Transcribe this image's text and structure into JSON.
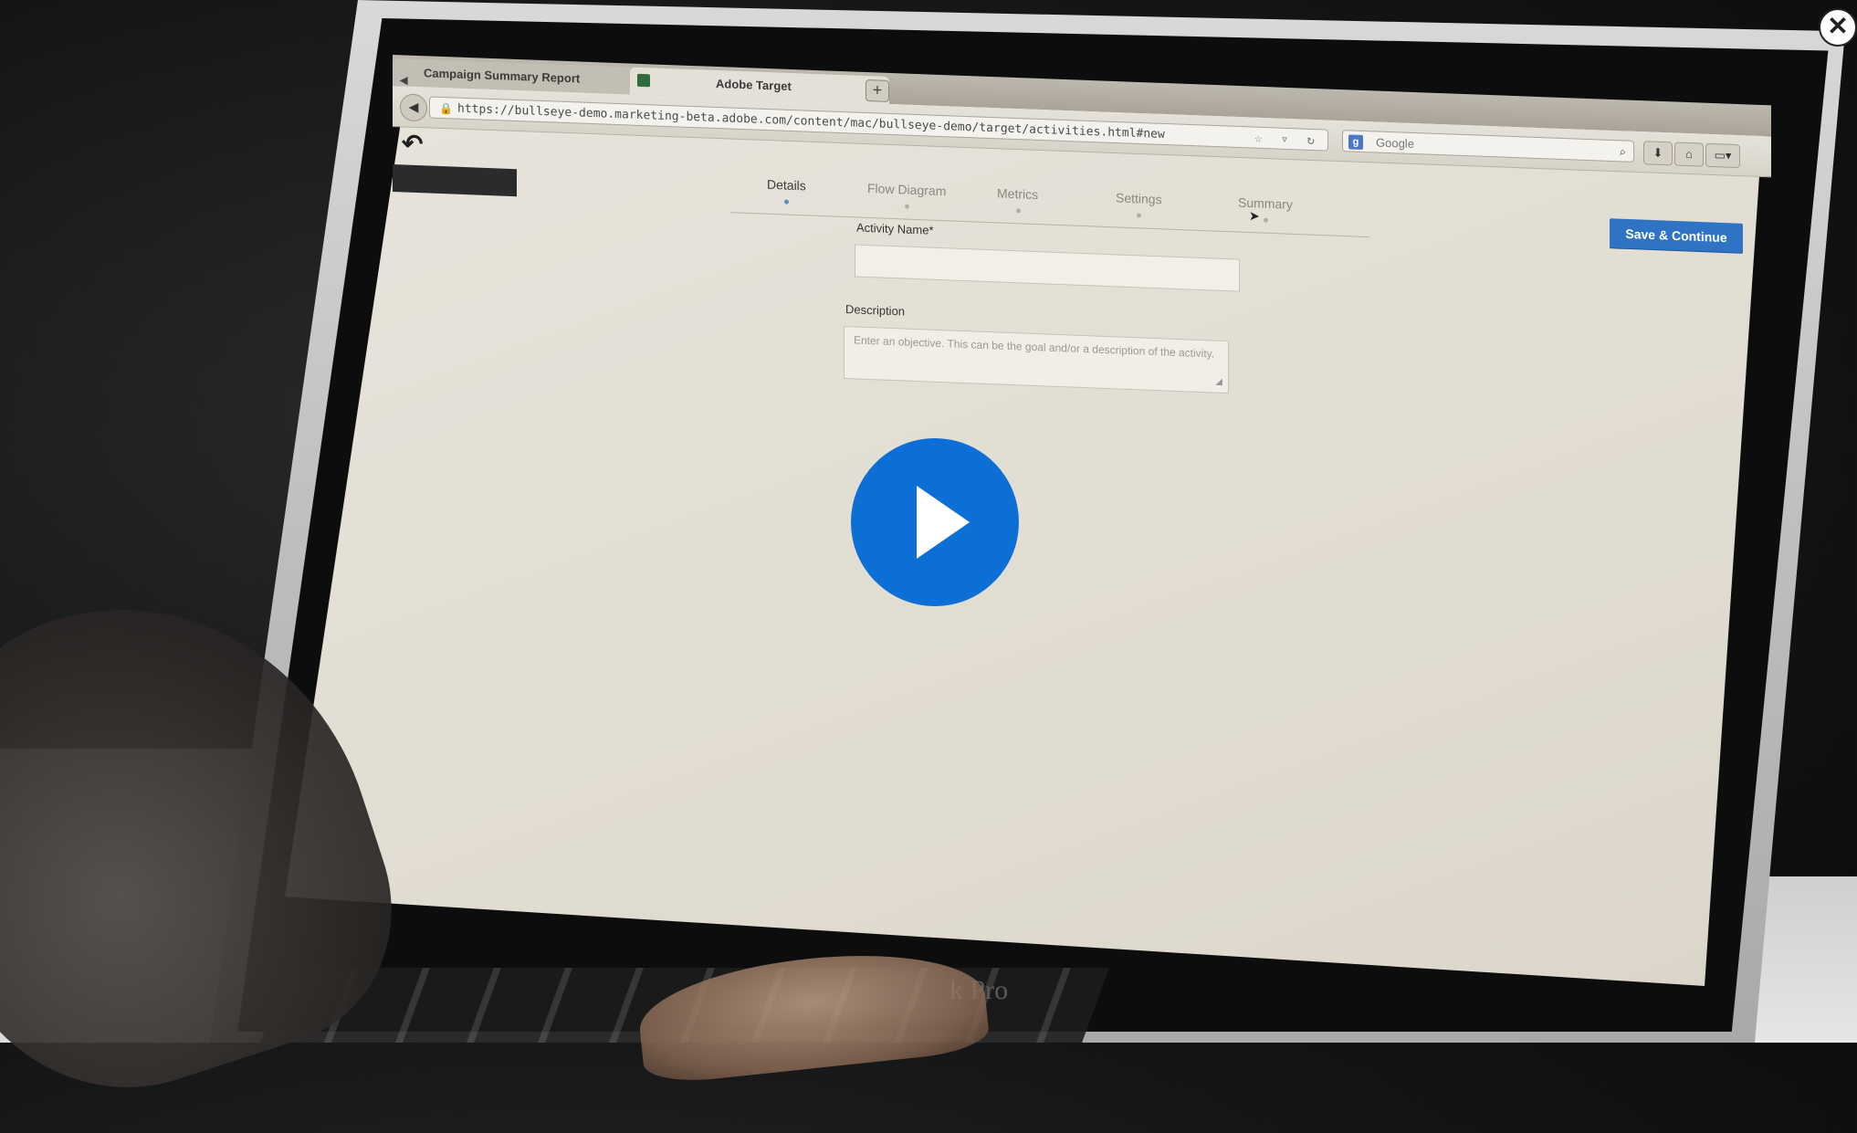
{
  "browser": {
    "tabs": [
      {
        "label": "Campaign Summary Report",
        "active": false
      },
      {
        "label": "Adobe Target",
        "active": true
      }
    ],
    "new_tab_label": "+",
    "url": "https://bullseye-demo.marketing-beta.adobe.com/content/mac/bullseye-demo/target/activities.html#new",
    "search_placeholder": "Google"
  },
  "app": {
    "steps": [
      "Details",
      "Flow Diagram",
      "Metrics",
      "Settings",
      "Summary"
    ],
    "active_step": "Details",
    "save_button": "Save & Continue",
    "activity_name_label": "Activity Name*",
    "activity_name_value": "",
    "description_label": "Description",
    "description_placeholder": "Enter an objective. This can be the goal and/or a description of the activity."
  },
  "device": {
    "brand_text": "k Pro"
  },
  "overlay": {
    "close_symbol": "✕",
    "accent_color": "#0b6fd6"
  }
}
